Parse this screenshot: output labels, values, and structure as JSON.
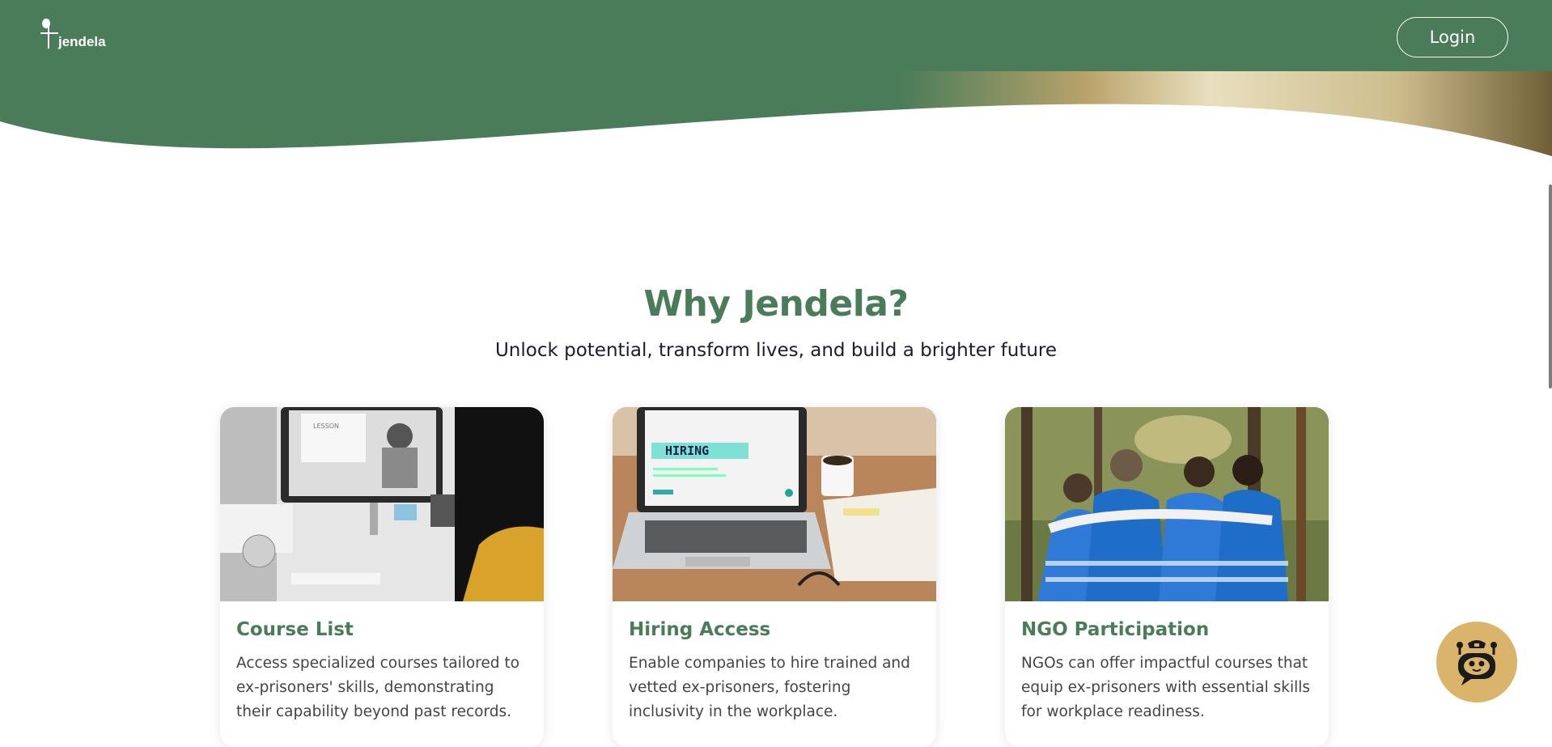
{
  "header": {
    "logo_text": "jendela",
    "login_label": "Login",
    "brand_color": "#4a7c59"
  },
  "hero": {
    "title": "Why Jendela?",
    "subtitle": "Unlock potential, transform lives, and build a brighter future"
  },
  "features": [
    {
      "title": "Course List",
      "description": "Access specialized courses tailored to ex-prisoners' skills, demonstrating their capability beyond past records.",
      "image_screen_text": "LESSON"
    },
    {
      "title": "Hiring Access",
      "description": "Enable companies to hire trained and vetted ex-prisoners, fostering inclusivity in the workplace.",
      "image_screen_text": "HIRING"
    },
    {
      "title": "NGO Participation",
      "description": "NGOs can offer impactful courses that equip ex-prisoners with essential skills for workplace readiness."
    }
  ],
  "chatbot": {
    "icon": "robot-icon",
    "bg_color": "#d9b46a"
  }
}
